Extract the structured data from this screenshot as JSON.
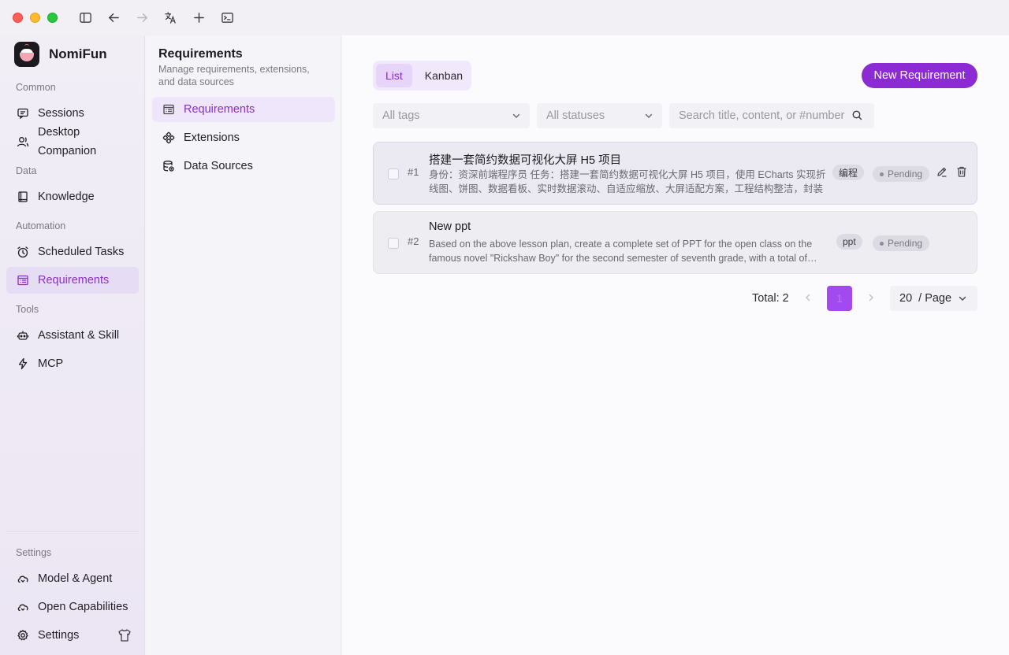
{
  "app": {
    "name": "NomiFun"
  },
  "sidebar": {
    "sections": {
      "common": "Common",
      "data": "Data",
      "automation": "Automation",
      "tools": "Tools",
      "settings": "Settings"
    },
    "items": [
      {
        "label": "Sessions",
        "icon": "chat-icon"
      },
      {
        "label": "Desktop Companion",
        "icon": "companion-icon"
      },
      {
        "label": "Knowledge",
        "icon": "book-icon"
      },
      {
        "label": "Scheduled Tasks",
        "icon": "alarm-clock-icon"
      },
      {
        "label": "Requirements",
        "icon": "list-icon",
        "active": true
      },
      {
        "label": "Assistant & Skill",
        "icon": "robot-icon"
      },
      {
        "label": "MCP",
        "icon": "lightning-icon"
      },
      {
        "label": "Model & Agent",
        "icon": "cloud-icon"
      },
      {
        "label": "Open Capabilities",
        "icon": "cloud-icon"
      },
      {
        "label": "Settings",
        "icon": "gear-icon"
      }
    ]
  },
  "subpanel": {
    "title": "Requirements",
    "description": "Manage requirements, extensions, and data sources",
    "items": [
      {
        "label": "Requirements",
        "icon": "list-icon",
        "active": true
      },
      {
        "label": "Extensions",
        "icon": "puzzle-icon"
      },
      {
        "label": "Data Sources",
        "icon": "database-icon"
      }
    ]
  },
  "main": {
    "view_toggle": {
      "list": "List",
      "kanban": "Kanban",
      "selected": "List"
    },
    "new_button": "New Requirement",
    "filters": {
      "tags_placeholder": "All tags",
      "status_placeholder": "All statuses",
      "search_placeholder": "Search title, content, or #number"
    },
    "requirements": [
      {
        "number": "#1",
        "title": "搭建一套简约数据可视化大屏 H5 项目",
        "description": "身份：资深前端程序员 任务：搭建一套简约数据可视化大屏 H5 项目，使用 ECharts 实现折线图、饼图、数据看板、实时数据滚动、自适应缩放、大屏适配方案，工程结构整洁，封装通用…",
        "tag": "编程",
        "status": "Pending"
      },
      {
        "number": "#2",
        "title": "New ppt",
        "description": "Based on the above lesson plan, create a complete set of PPT for the open class on the famous novel \"Rickshaw Boy\" for the second semester of seventh grade, with a total of…",
        "tag": "ppt",
        "status": "Pending"
      }
    ],
    "pagination": {
      "total_label": "Total: 2",
      "current_page": "1",
      "page_size": "20",
      "page_size_suffix": "/ Page"
    }
  },
  "colors": {
    "accent": "#8c2bd3",
    "active_bg": "#e6dcf4"
  }
}
